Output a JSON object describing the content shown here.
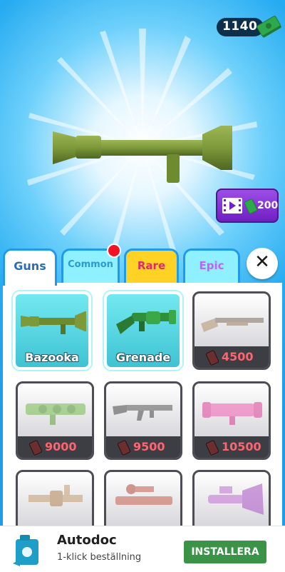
{
  "currency": {
    "amount": "1140",
    "icon": "cash-stack-icon",
    "color": "#2ea84a"
  },
  "featured": {
    "weapon_icon": "bazooka-icon",
    "weapon_color": "#7d9a3a"
  },
  "video_reward": {
    "amount": "200",
    "icon": "video-play-icon"
  },
  "tabs": [
    {
      "label": "Guns",
      "selected": true
    },
    {
      "label": "Common",
      "notification": true
    },
    {
      "label": "Rare"
    },
    {
      "label": "Epic"
    }
  ],
  "close_icon": "close-icon",
  "shop": {
    "items": [
      {
        "name": "Bazooka",
        "unlocked": true,
        "icon": "bazooka-icon"
      },
      {
        "name": "Grenade",
        "unlocked": true,
        "icon": "grenade-launcher-icon"
      },
      {
        "price": "4500",
        "unlocked": false,
        "icon": "rifle-icon"
      },
      {
        "price": "9000",
        "unlocked": false,
        "icon": "launcher-icon"
      },
      {
        "price": "9500",
        "unlocked": false,
        "icon": "assault-rifle-icon"
      },
      {
        "price": "10500",
        "unlocked": false,
        "icon": "pink-launcher-icon"
      },
      {
        "unlocked": false,
        "icon": "cannon-icon"
      },
      {
        "unlocked": false,
        "icon": "scoped-cannon-icon"
      },
      {
        "unlocked": false,
        "icon": "ray-gun-icon"
      }
    ]
  },
  "ad": {
    "title": "Autodoc",
    "subtitle": "1-klick beställning",
    "button": "INSTALLERA",
    "button_color": "#3b9347"
  }
}
